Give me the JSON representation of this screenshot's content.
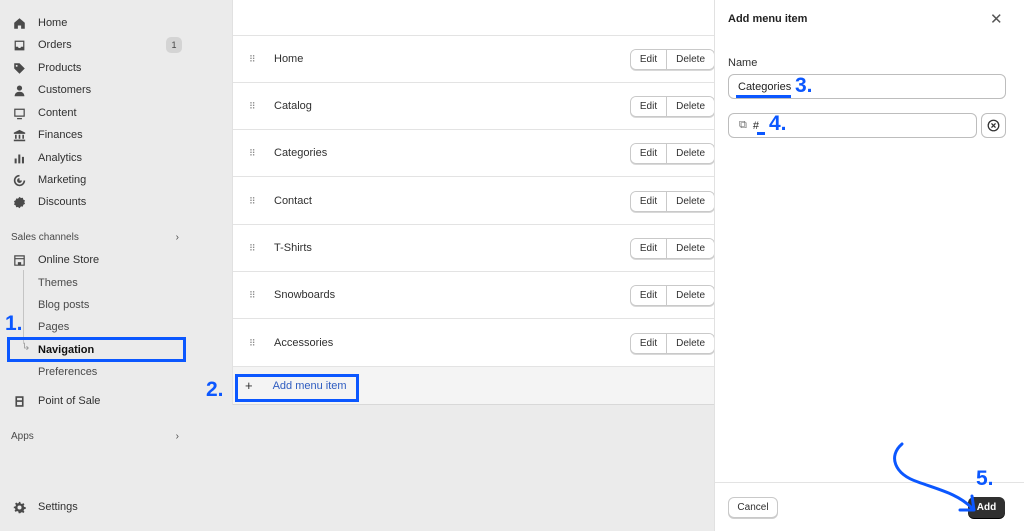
{
  "sidebar": {
    "items": [
      {
        "label": "Home",
        "icon": "home-icon"
      },
      {
        "label": "Orders",
        "icon": "inbox-icon",
        "badge": "1"
      },
      {
        "label": "Products",
        "icon": "tag-icon"
      },
      {
        "label": "Customers",
        "icon": "person-icon"
      },
      {
        "label": "Content",
        "icon": "image-icon"
      },
      {
        "label": "Finances",
        "icon": "bank-icon"
      },
      {
        "label": "Analytics",
        "icon": "bar-chart-icon"
      },
      {
        "label": "Marketing",
        "icon": "target-icon"
      },
      {
        "label": "Discounts",
        "icon": "discount-icon"
      }
    ],
    "sales_channels_label": "Sales channels",
    "online_store_label": "Online Store",
    "online_store_sub": [
      "Themes",
      "Blog posts",
      "Pages",
      "Navigation",
      "Preferences"
    ],
    "point_of_sale_label": "Point of Sale",
    "apps_label": "Apps",
    "settings_label": "Settings"
  },
  "menu": {
    "items": [
      "Home",
      "Catalog",
      "Categories",
      "Contact",
      "T-Shirts",
      "Snowboards",
      "Accessories"
    ],
    "edit_label": "Edit",
    "delete_label": "Delete",
    "add_label": "Add menu item"
  },
  "panel": {
    "title": "Add menu item",
    "name_label": "Name",
    "name_value": "Categories",
    "link_value": "#",
    "cancel_label": "Cancel",
    "add_label": "Add"
  },
  "annotations": {
    "steps": [
      "1.",
      "2.",
      "3.",
      "4.",
      "5."
    ],
    "color": "#0b57ff"
  }
}
